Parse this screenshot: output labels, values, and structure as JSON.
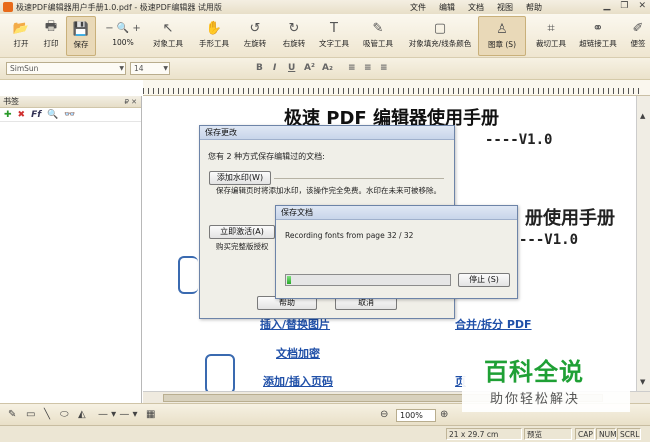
{
  "window": {
    "title": "极速PDF编辑器用户手册1.0.pdf - 极速PDF编辑器 试用版",
    "menus": [
      "文件",
      "编辑",
      "文档",
      "视图",
      "帮助"
    ]
  },
  "toolbar": {
    "items": [
      {
        "label": "打开",
        "icon": "folder-open-icon",
        "glyph": "📂"
      },
      {
        "label": "打印",
        "icon": "printer-icon",
        "glyph": "🖶"
      },
      {
        "label": "保存",
        "icon": "save-icon",
        "glyph": "💾"
      },
      {
        "label": "100%",
        "icon": "zoom-icon",
        "glyph": "− 🔍 +"
      },
      {
        "label": "对象工具",
        "icon": "pointer-icon",
        "glyph": "↖"
      },
      {
        "label": "手形工具",
        "icon": "hand-icon",
        "glyph": "✋"
      },
      {
        "label": "左旋转",
        "icon": "rotate-left-icon",
        "glyph": "↺"
      },
      {
        "label": "右旋转",
        "icon": "rotate-right-icon",
        "glyph": "↻"
      },
      {
        "label": "文字工具",
        "icon": "text-tool-icon",
        "glyph": "T"
      },
      {
        "label": "吸管工具",
        "icon": "eyedropper-icon",
        "glyph": "✎"
      },
      {
        "label": "对象填充/线条颜色",
        "icon": "fill-color-icon",
        "glyph": "▢"
      },
      {
        "label": "图章 (S)",
        "icon": "stamp-icon",
        "glyph": "♙"
      },
      {
        "label": "裁切工具",
        "icon": "crop-icon",
        "glyph": "⌗"
      },
      {
        "label": "超链接工具",
        "icon": "link-icon",
        "glyph": "⚭"
      },
      {
        "label": "便签",
        "icon": "note-icon",
        "glyph": "✐"
      }
    ]
  },
  "format": {
    "font": "SimSun",
    "size": "14",
    "bold": "B",
    "italic": "I",
    "underline": "U",
    "superscript": "A²",
    "subscript": "A₂"
  },
  "sidebar": {
    "title": "书签",
    "pins": "₽ ✕",
    "tools": [
      "✚",
      "✖",
      "Ff",
      "🔍",
      "👓"
    ]
  },
  "document": {
    "title": "极速 PDF 编辑器使用手册",
    "version": "----V1.0",
    "title2": "册使用手册",
    "version2": "---V1.0",
    "links": [
      "插入/替换图片",
      "合并/拆分 PDF",
      "文档加密",
      "添加/插入页码",
      "页"
    ]
  },
  "save_dialog": {
    "title": "保存更改",
    "question": "您有 2 种方式保存编辑过的文档:",
    "watermark_button": "添加水印(W)",
    "watermark_desc": "保存编辑页时将添加水印，该操作完全免费。水印在未来可被移除。",
    "register_button": "立即激活(A)",
    "register_desc": "购买完整版授权",
    "help_button": "帮助",
    "cancel_button": "取消"
  },
  "progress_dialog": {
    "title": "保存文档",
    "message": "Recording fonts from page 32 / 32",
    "progress": 0.02,
    "stop_button": "停止 (S)"
  },
  "bottombar": {
    "zoom": "100%",
    "page_input": ""
  },
  "status": {
    "page_size": "21 x 29.7 cm",
    "mode": "预览",
    "cap": "CAP",
    "num": "NUM",
    "scrl": "SCRL"
  },
  "watermark_overlay": {
    "big": "百科全说",
    "small": "助你轻松解决"
  }
}
